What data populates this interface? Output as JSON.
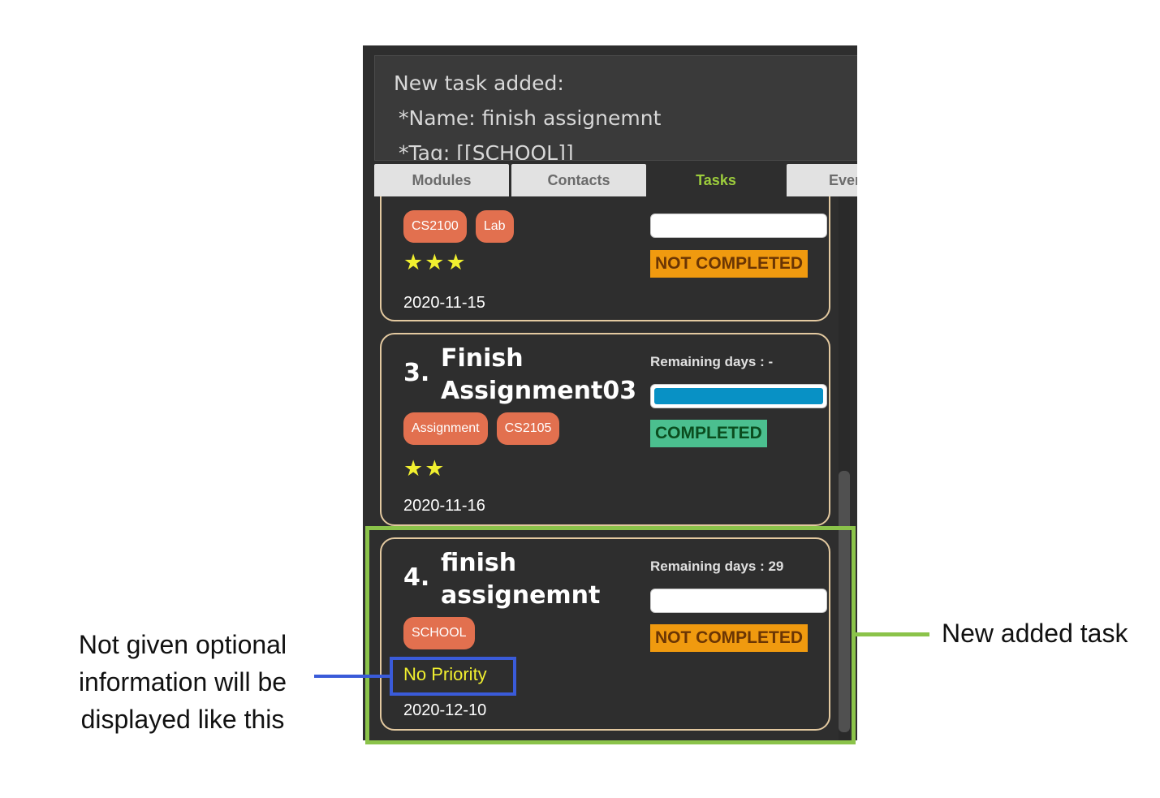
{
  "result_box": {
    "lines": [
      "New task added:",
      "*Name: finish assignemnt",
      "*Tag: [[SCHOOL]]"
    ]
  },
  "tabs": [
    {
      "label": "Modules",
      "active": false
    },
    {
      "label": "Contacts",
      "active": false
    },
    {
      "label": "Tasks",
      "active": true
    },
    {
      "label": "Events",
      "active": false
    }
  ],
  "tasks": [
    {
      "index": "",
      "title": "",
      "tags": [
        "CS2100",
        "Lab"
      ],
      "priority_stars": "★★★",
      "date": "2020-11-15",
      "remaining": "",
      "progress": 0,
      "status": "NOT COMPLETED"
    },
    {
      "index": "3.",
      "title": "Finish Assignment03",
      "tags": [
        "Assignment",
        "CS2105"
      ],
      "priority_stars": "★★",
      "date": "2020-11-16",
      "remaining": "Remaining days : -",
      "progress": 1.0,
      "status": "COMPLETED"
    },
    {
      "index": "4.",
      "title": "finish assignemnt",
      "tags": [
        "SCHOOL"
      ],
      "priority_text": "No Priority",
      "date": "2020-12-10",
      "remaining": "Remaining days : 29",
      "progress": 0,
      "status": "NOT COMPLETED"
    }
  ],
  "annotations": {
    "right_note": "New added task",
    "left_note": "Not given optional information will be displayed like this",
    "colors": {
      "green": "#8bc34a",
      "blue": "#3a5bd9"
    }
  }
}
